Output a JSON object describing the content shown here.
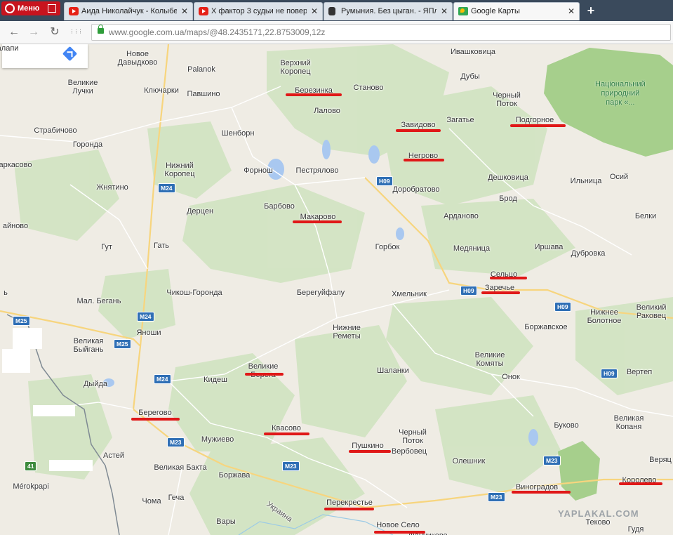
{
  "tabs": [
    {
      "opera_label": "Меню"
    },
    {
      "title": "Аида Николайчук - Колыбел",
      "icon": "youtube-icon"
    },
    {
      "title": "Х фактор 3 судьи не повери",
      "icon": "youtube-icon"
    },
    {
      "title": "Румыния. Без цыган. - ЯПла",
      "icon": "yaplakal-icon"
    },
    {
      "title": "Google Карты",
      "icon": "google-maps-icon"
    }
  ],
  "tab_close": "✕",
  "new_tab": "+",
  "nav": {
    "back": "←",
    "forward": "→",
    "reload": "↻",
    "apps": "⋮⋮⋮"
  },
  "url": "www.google.com.ua/maps/@48.2435171,22.8753009,12z",
  "map": {
    "places": [
      {
        "name": "Новое\nДавыдково"
      },
      {
        "name": "Palanok"
      },
      {
        "name": "Верхний\nКоропец"
      },
      {
        "name": "Ивашковица"
      },
      {
        "name": "Великие\nЛучки"
      },
      {
        "name": "Ключарки"
      },
      {
        "name": "Павшино"
      },
      {
        "name": "Березинка"
      },
      {
        "name": "Станово"
      },
      {
        "name": "Дубы"
      },
      {
        "name": "Лалово"
      },
      {
        "name": "Черный\nПоток"
      },
      {
        "name": "Загатье"
      },
      {
        "name": "Завидово"
      },
      {
        "name": "Подгорное"
      },
      {
        "name": "Страбичово"
      },
      {
        "name": "Шенборн"
      },
      {
        "name": "Горонда"
      },
      {
        "name": "Негрово"
      },
      {
        "name": "аркасово"
      },
      {
        "name": "Нижний\nКоропец"
      },
      {
        "name": "Форнош"
      },
      {
        "name": "Пестрялово"
      },
      {
        "name": "Дешковица"
      },
      {
        "name": "Осий"
      },
      {
        "name": "Жнятино"
      },
      {
        "name": "Доробратово"
      },
      {
        "name": "Ильница"
      },
      {
        "name": "Брод"
      },
      {
        "name": "Барбово"
      },
      {
        "name": "Дерцен"
      },
      {
        "name": "Белки"
      },
      {
        "name": "айново"
      },
      {
        "name": "Макарово"
      },
      {
        "name": "Арданово"
      },
      {
        "name": "Гут"
      },
      {
        "name": "Гать"
      },
      {
        "name": "Горбок"
      },
      {
        "name": "Медяница"
      },
      {
        "name": "Иршава"
      },
      {
        "name": "Дубровка"
      },
      {
        "name": "Сельцо"
      },
      {
        "name": "ь"
      },
      {
        "name": "Чикош-Горонда"
      },
      {
        "name": "Берегуйфалу"
      },
      {
        "name": "Заречье"
      },
      {
        "name": "Хмельник"
      },
      {
        "name": "Мал. Бегань"
      },
      {
        "name": "Великий\nРаковец"
      },
      {
        "name": "Нижнее\nБолотное"
      },
      {
        "name": "Нижние\nРеметы"
      },
      {
        "name": "Яноши"
      },
      {
        "name": "Боржавское"
      },
      {
        "name": "Великая\nБыйгань"
      },
      {
        "name": "Великие\nКомяты"
      },
      {
        "name": "Великие\nБерега"
      },
      {
        "name": "Шаланки"
      },
      {
        "name": "Вертеп"
      },
      {
        "name": "Кидеш"
      },
      {
        "name": "Онок"
      },
      {
        "name": "Дыйда"
      },
      {
        "name": "Береговo"
      },
      {
        "name": "Великая\nКопаня"
      },
      {
        "name": "Буково"
      },
      {
        "name": "Квасово"
      },
      {
        "name": "Черный\nПоток"
      },
      {
        "name": "Мужиево"
      },
      {
        "name": "Пушкино"
      },
      {
        "name": "Вербовец"
      },
      {
        "name": "Астей"
      },
      {
        "name": "Олешник"
      },
      {
        "name": "Веряц"
      },
      {
        "name": "Великая Бакта"
      },
      {
        "name": "Боржава"
      },
      {
        "name": "Королево"
      },
      {
        "name": "Виноградов"
      },
      {
        "name": "Mérokpapi"
      },
      {
        "name": "Чома"
      },
      {
        "name": "Геча"
      },
      {
        "name": "Перекрестье"
      },
      {
        "name": "Вары"
      },
      {
        "name": "Новое Село"
      },
      {
        "name": "Украина"
      },
      {
        "name": "Текoвo"
      },
      {
        "name": "Гудя"
      },
      {
        "name": "Фанчиково"
      },
      {
        "name": "Юлкалапи"
      }
    ],
    "park_label": "Національний\nприродний\nпарк «...",
    "roads": [
      "M24",
      "H09",
      "M24",
      "H09",
      "M24",
      "M25",
      "M25",
      "M24",
      "M23",
      "M23",
      "M23",
      "H09",
      "M23",
      "M23",
      "41"
    ],
    "highlight_color": "#e01818",
    "watermark": "YAPLAKAL.COM"
  }
}
